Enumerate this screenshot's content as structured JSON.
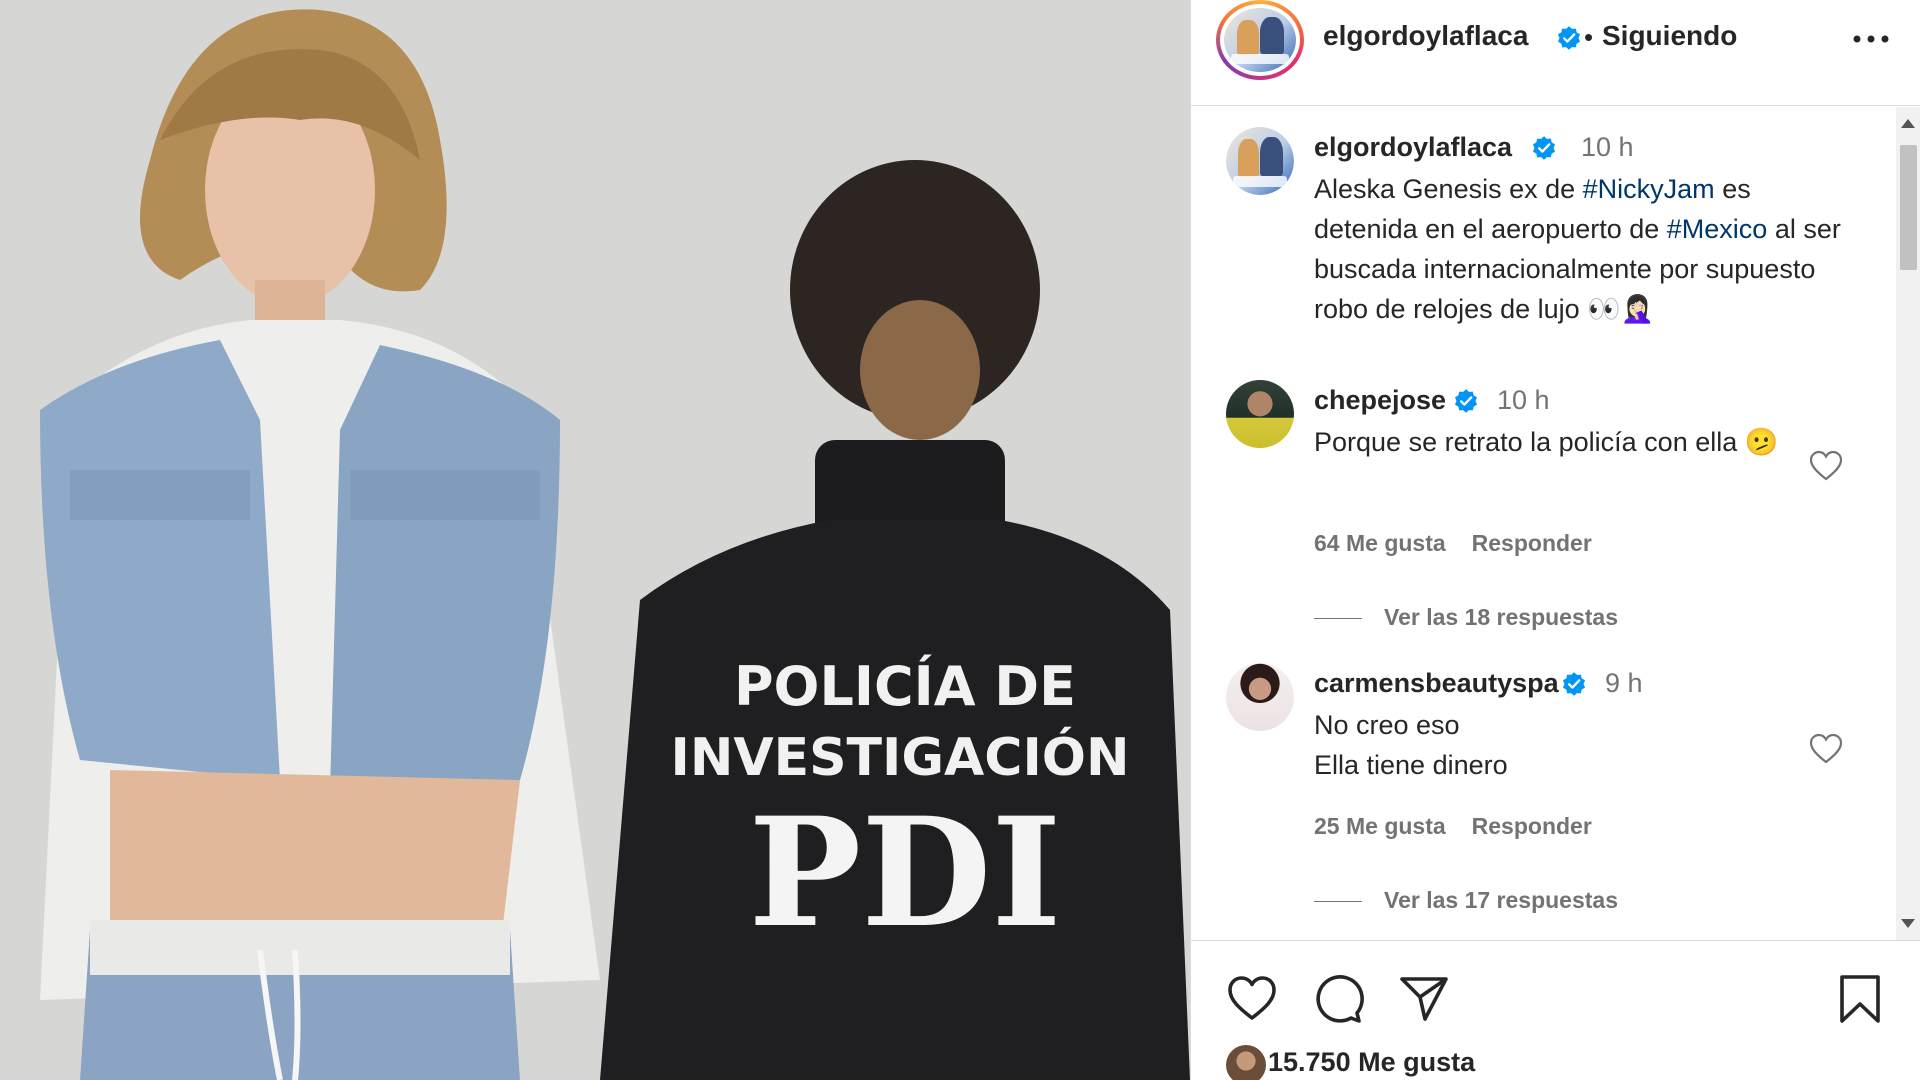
{
  "post": {
    "author": "elgordoylaflaca",
    "follow_status": "Siguiendo",
    "jacket_text_line1": "POLICÍA DE",
    "jacket_text_line2": "INVESTIGACIÓN",
    "jacket_text_line3": "PDI"
  },
  "caption": {
    "author": "elgordoylaflaca",
    "time": "10 h",
    "text_part1": "Aleska Genesis ex de ",
    "hashtag1": "#NickyJam",
    "text_part2": " es detenida en el aeropuerto de ",
    "hashtag2": "#Mexico",
    "text_part3": " al ser buscada internacionalmente por supuesto robo de relojes de lujo 👀🤦🏻‍♀️"
  },
  "comments": [
    {
      "author": "chepejose",
      "time": "10 h",
      "text": "Porque se retrato la policía con ella 🫤",
      "likes": "64 Me gusta",
      "reply": "Responder",
      "replies": "Ver las 18 respuestas"
    },
    {
      "author": "carmensbeautyspa",
      "time": "9 h",
      "text_line1": "No creo eso",
      "text_line2": "Ella tiene dinero",
      "likes": "25 Me gusta",
      "reply": "Responder",
      "replies": "Ver las 17 respuestas"
    }
  ],
  "footer": {
    "likes": "15.750 Me gusta"
  },
  "icons": {
    "verified_color": "#0095f6",
    "hashtag_color": "#00376b"
  }
}
